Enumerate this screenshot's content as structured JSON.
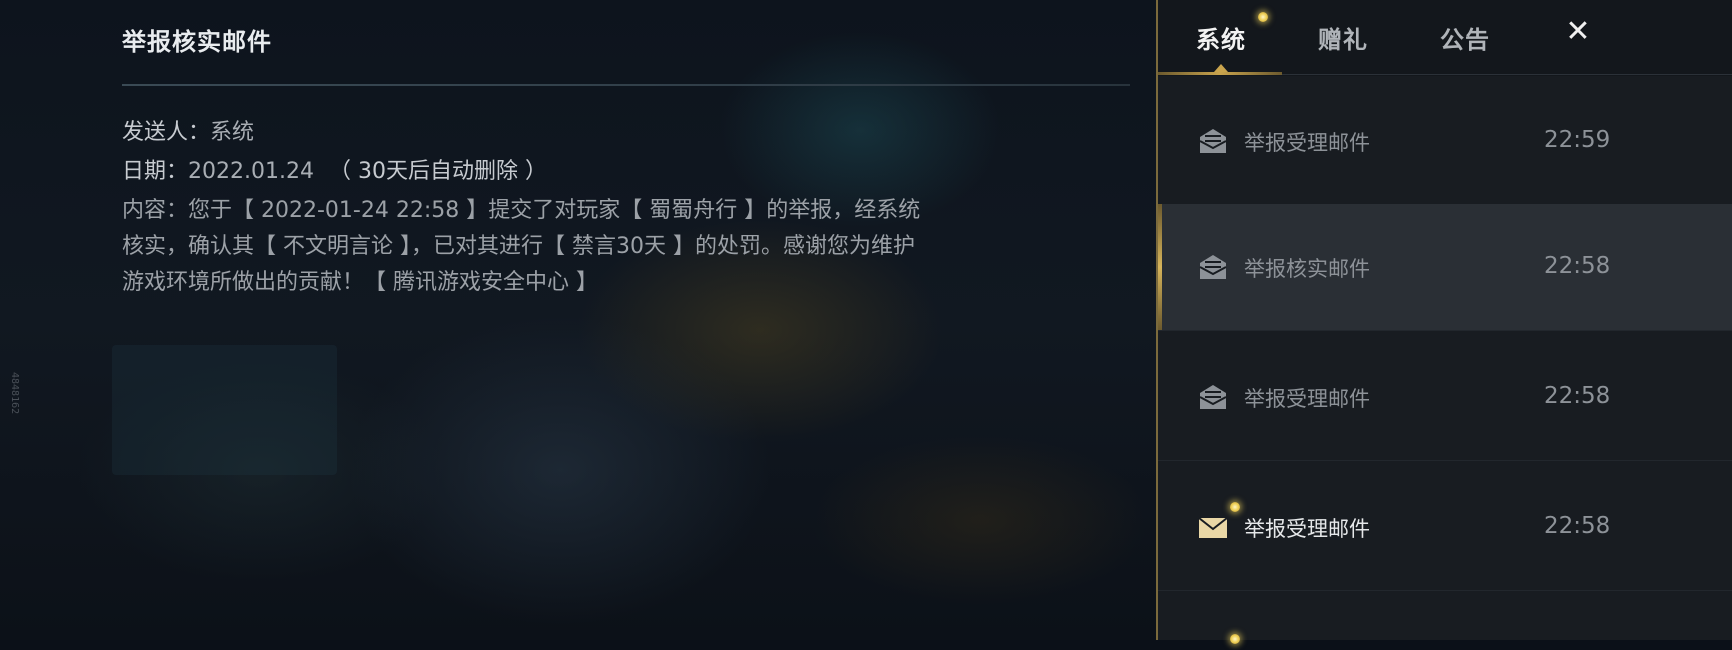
{
  "detail": {
    "title": "举报核实邮件",
    "sender_label": "发送人：",
    "sender_value": "系统",
    "date_label": "日期：",
    "date_value": "2022.01.24",
    "date_note": "（ 30天后自动删除 ）",
    "content_label": "内容：",
    "content_body": "您于【 2022-01-24 22:58 】提交了对玩家【 蜀蜀舟行 】的举报，经系统核实，确认其【 不文明言论 】，已对其进行【 禁言30天 】的处罚。感谢您为维护游戏环境所做出的贡献！【 腾讯游戏安全中心 】"
  },
  "side_mark": "4848162",
  "tabs": [
    {
      "label": "系统",
      "active": true,
      "has_dot": true
    },
    {
      "label": "赠礼",
      "active": false,
      "has_dot": false
    },
    {
      "label": "公告",
      "active": false,
      "has_dot": false
    }
  ],
  "close_icon": "close-icon",
  "mails": [
    {
      "subject": "举报受理邮件",
      "time": "22:59",
      "read": true,
      "selected": false,
      "icon": "mail-opened-icon"
    },
    {
      "subject": "举报核实邮件",
      "time": "22:58",
      "read": true,
      "selected": true,
      "icon": "mail-opened-icon"
    },
    {
      "subject": "举报受理邮件",
      "time": "22:58",
      "read": true,
      "selected": false,
      "icon": "mail-opened-icon"
    },
    {
      "subject": "举报受理邮件",
      "time": "22:58",
      "read": false,
      "selected": false,
      "icon": "mail-unread-icon"
    }
  ],
  "colors": {
    "accent_gold": "#c9a44d",
    "unread_icon": "#e9d7a6",
    "read_icon": "#8d9298"
  }
}
